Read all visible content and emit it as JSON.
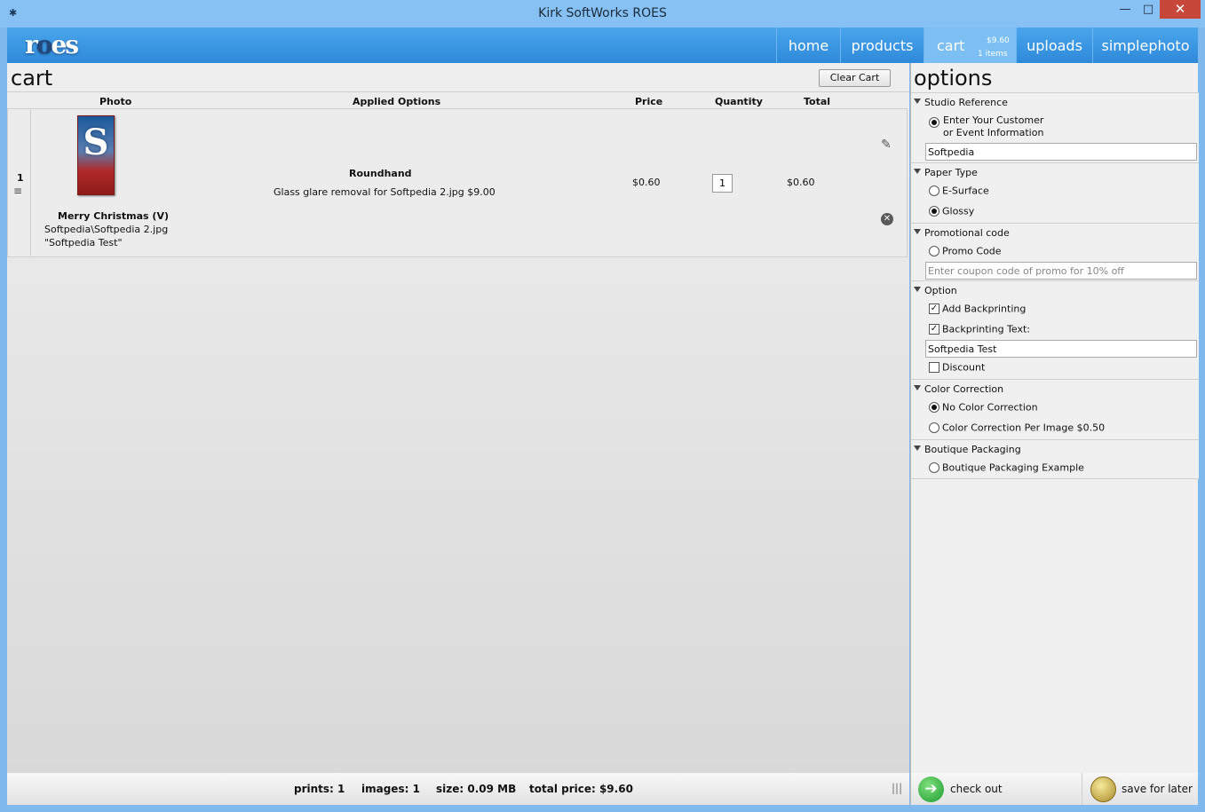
{
  "window": {
    "title": "Kirk SoftWorks ROES",
    "min_glyph": "—",
    "max_glyph": "□",
    "close_glyph": "✕"
  },
  "header": {
    "logo_text_a": "r",
    "logo_text_b": "o",
    "logo_text_c": "es",
    "nav": {
      "home": "home",
      "products": "products",
      "cart": "cart",
      "cart_price": "$9.60",
      "cart_items": "1 items",
      "uploads": "uploads",
      "simplephoto": "simplephoto"
    }
  },
  "cart": {
    "title": "cart",
    "clear_label": "Clear Cart",
    "columns": {
      "photo": "Photo",
      "options": "Applied Options",
      "price": "Price",
      "quantity": "Quantity",
      "total": "Total"
    },
    "rows": [
      {
        "index": "1",
        "thumb_letter": "S",
        "photo_title": "Merry Christmas (V)",
        "photo_path": "Softpedia\\Softpedia 2.jpg",
        "photo_caption": "\"Softpedia Test\"",
        "option_name": "Roundhand",
        "option_line": "Glass glare removal for Softpedia 2.jpg  $9.00",
        "price": "$0.60",
        "quantity": "1",
        "total": "$0.60"
      }
    ]
  },
  "status": {
    "prints": "prints: 1",
    "images": "images: 1",
    "size": "size: 0.09 MB",
    "total_price": "total price: $9.60"
  },
  "options": {
    "title": "options",
    "sections": {
      "studio": {
        "title": "Studio Reference",
        "radio_line1": "Enter Your Customer",
        "radio_line2": "or Event Information",
        "value": "Softpedia"
      },
      "paper": {
        "title": "Paper Type",
        "opt1": "E-Surface",
        "opt2": "Glossy"
      },
      "promo": {
        "title": "Promotional code",
        "opt1": "Promo Code",
        "placeholder": "Enter coupon code of promo for 10% off"
      },
      "option": {
        "title": "Option",
        "opt1": "Add Backprinting",
        "opt2": "Backprinting Text:",
        "value": "Softpedia Test",
        "opt3": "Discount"
      },
      "color": {
        "title": "Color Correction",
        "opt1": "No Color Correction",
        "opt2": "Color Correction Per Image $0.50"
      },
      "boutique": {
        "title": "Boutique Packaging",
        "opt1": "Boutique Packaging Example"
      }
    }
  },
  "actions": {
    "checkout_label": "check out",
    "checkout_glyph": "➔",
    "save_label": "save for later"
  }
}
